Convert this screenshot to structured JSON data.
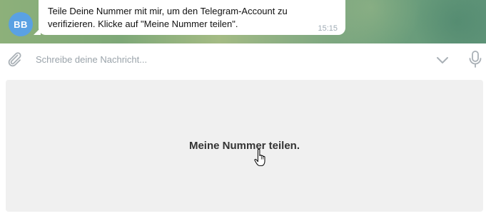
{
  "message": {
    "sender_initials": "BB",
    "text": "Teile Deine Nummer mit mir, um den Telegram-Account zu verifizieren. Klicke auf \"Meine Nummer teilen\".",
    "time": "15:15"
  },
  "composer": {
    "placeholder": "Schreibe deine Nachricht...",
    "value": ""
  },
  "keyboard": {
    "button_label": "Meine Nummer teilen."
  },
  "colors": {
    "avatar": "#5aa1e3",
    "keyboard_button": "#f0f0f0",
    "chat_background": "#7ea878"
  },
  "icons": {
    "attach": "paperclip-icon",
    "chevron": "chevron-down-icon",
    "voice": "microphone-icon",
    "cursor": "hand-pointer-icon"
  }
}
